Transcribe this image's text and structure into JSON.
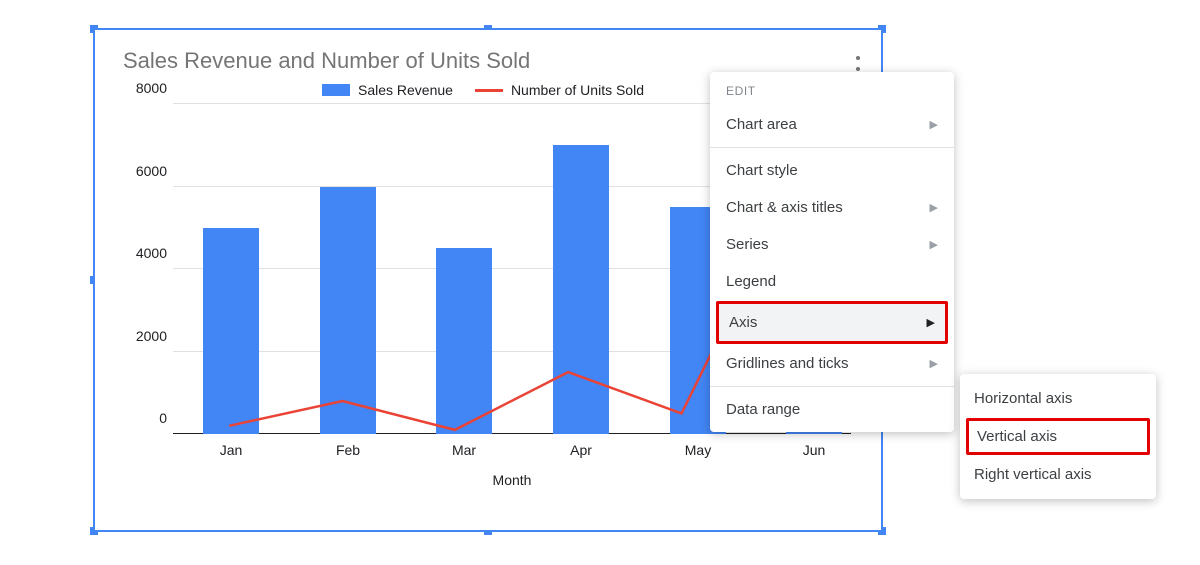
{
  "chart_data": {
    "type": "combo",
    "title": "Sales Revenue and Number of Units Sold",
    "xlabel": "Month",
    "ylabel": "",
    "ylim": [
      0,
      8000
    ],
    "yticks": [
      0,
      2000,
      4000,
      6000,
      8000
    ],
    "categories": [
      "Jan",
      "Feb",
      "Mar",
      "Apr",
      "May",
      "Jun"
    ],
    "series": [
      {
        "name": "Sales Revenue",
        "type": "bar",
        "color": "#4285f4",
        "values": [
          5000,
          6000,
          4500,
          7000,
          5500,
          6500
        ]
      },
      {
        "name": "Number of Units Sold",
        "type": "line",
        "color": "#ea4335",
        "values": [
          200,
          800,
          100,
          1500,
          500,
          6000
        ]
      }
    ],
    "legend_position": "top"
  },
  "legend": {
    "s0": "Sales Revenue",
    "s1": "Number of Units Sold"
  },
  "yticks": {
    "t0": "0",
    "t1": "2000",
    "t2": "4000",
    "t3": "6000",
    "t4": "8000"
  },
  "xticks": {
    "c0": "Jan",
    "c1": "Feb",
    "c2": "Mar",
    "c3": "Apr",
    "c4": "May",
    "c5": "Jun"
  },
  "menu": {
    "header": "EDIT",
    "chart_area": "Chart area",
    "chart_style": "Chart style",
    "chart_axis_titles": "Chart & axis titles",
    "series": "Series",
    "legend": "Legend",
    "axis": "Axis",
    "gridlines": "Gridlines and ticks",
    "data_range": "Data range"
  },
  "submenu": {
    "horizontal": "Horizontal axis",
    "vertical": "Vertical axis",
    "right_vertical": "Right vertical axis"
  }
}
